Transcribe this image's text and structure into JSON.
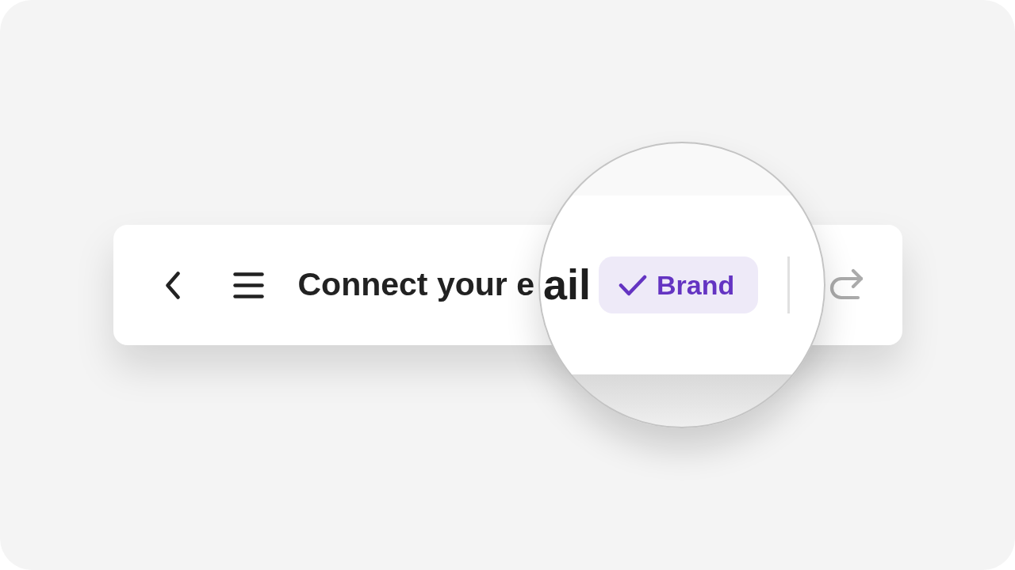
{
  "toolbar": {
    "back_button": {
      "disabled": false
    },
    "menu_button": {
      "disabled": false
    },
    "title": "Connect your e",
    "redo_button": {
      "disabled": true
    }
  },
  "magnifier": {
    "title_fragment": "ail",
    "badge": {
      "label": "Brand",
      "selected": true
    }
  }
}
